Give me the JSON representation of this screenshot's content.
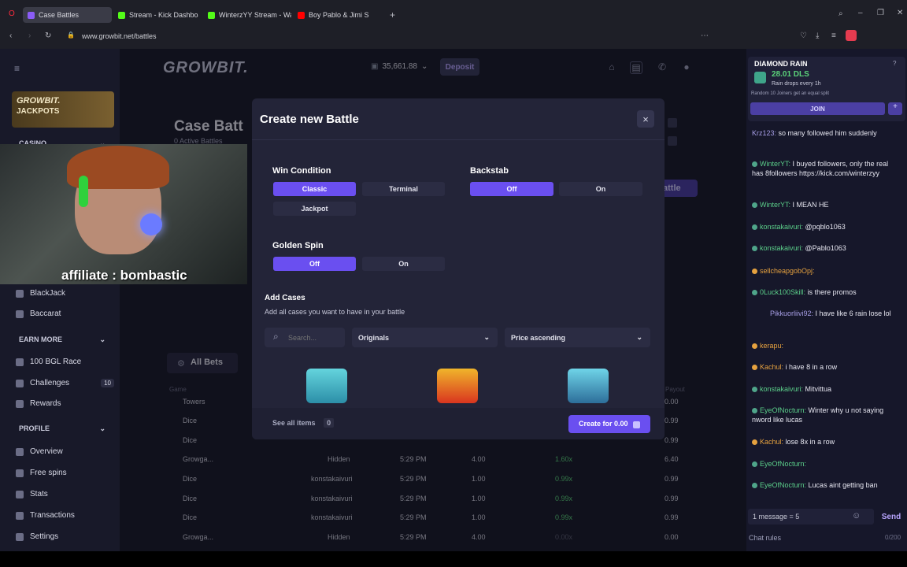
{
  "browser": {
    "tabs": [
      {
        "label": "Case Battles",
        "color": "#8b5cf6"
      },
      {
        "label": "Stream - Kick Dashboard",
        "color": "#53fc18"
      },
      {
        "label": "WinterzYY Stream - Watch",
        "color": "#53fc18"
      },
      {
        "label": "Boy Pablo & Jimi S",
        "color": "#ff0000"
      }
    ],
    "url": "www.growbit.net/battles"
  },
  "header": {
    "logo": "GROWBIT.",
    "balance": "35,661.88",
    "deposit_label": "Deposit"
  },
  "sidebar": {
    "jackpots_line1": "GROWBIT.",
    "jackpots_line2": "JACKPOTS",
    "casino_label": "CASINO",
    "casino_items": [
      {
        "label": "BlackJack"
      },
      {
        "label": "Baccarat"
      }
    ],
    "earn_more_label": "EARN MORE",
    "earn_items": [
      {
        "label": "100 BGL Race"
      },
      {
        "label": "Challenges",
        "badge": "10"
      },
      {
        "label": "Rewards"
      }
    ],
    "profile_label": "PROFILE",
    "profile_items": [
      {
        "label": "Overview"
      },
      {
        "label": "Free spins"
      },
      {
        "label": "Stats"
      },
      {
        "label": "Transactions"
      },
      {
        "label": "Settings"
      }
    ]
  },
  "page": {
    "title": "Case Batt",
    "subtitle": "0 Active Battles",
    "right_button": "attle",
    "all_bets_label": "All Bets",
    "game_header": "Game",
    "payout_header": "Payout",
    "rows": [
      {
        "game": "Towers",
        "user": "",
        "time": "",
        "amount": "",
        "mult": "",
        "payout": "0.00"
      },
      {
        "game": "Dice",
        "user": "",
        "time": "",
        "amount": "",
        "mult": "",
        "payout": "0.99"
      },
      {
        "game": "Dice",
        "user": "konstakaivuri",
        "time": "",
        "amount": "",
        "mult": "",
        "payout": "0.99"
      },
      {
        "game": "Growga...",
        "user": "Hidden",
        "time": "5:29 PM",
        "amount": "4.00",
        "mult": "1.60x",
        "payout": "6.40"
      },
      {
        "game": "Dice",
        "user": "konstakaivuri",
        "time": "5:29 PM",
        "amount": "1.00",
        "mult": "0.99x",
        "payout": "0.99"
      },
      {
        "game": "Dice",
        "user": "konstakaivuri",
        "time": "5:29 PM",
        "amount": "1.00",
        "mult": "0.99x",
        "payout": "0.99"
      },
      {
        "game": "Dice",
        "user": "konstakaivuri",
        "time": "5:29 PM",
        "amount": "1.00",
        "mult": "0.99x",
        "payout": "0.99"
      },
      {
        "game": "Growga...",
        "user": "Hidden",
        "time": "5:29 PM",
        "amount": "4.00",
        "mult": "0.00x",
        "payout": "0.00"
      }
    ]
  },
  "webcam": {
    "overlay_text": "affiliate : bombastic"
  },
  "modal": {
    "title": "Create new Battle",
    "close_icon": "×",
    "win_condition": {
      "title": "Win Condition",
      "options": [
        "Classic",
        "Terminal",
        "Jackpot"
      ],
      "selected": "Classic"
    },
    "backstab": {
      "title": "Backstab",
      "options": [
        "Off",
        "On"
      ],
      "selected": "Off"
    },
    "golden_spin": {
      "title": "Golden Spin",
      "options": [
        "Off",
        "On"
      ],
      "selected": "Off"
    },
    "add_cases": {
      "title": "Add Cases",
      "subtitle": "Add all cases you want to have in your battle",
      "search_placeholder": "Search...",
      "category": "Originals",
      "sort": "Price ascending"
    },
    "cases": [
      {
        "color": "#3fb6c9"
      },
      {
        "color": "#e8471f"
      },
      {
        "color": "#58b9d8"
      }
    ],
    "see_all_label": "See all items",
    "see_all_count": "0",
    "create_label": "Create for 0.00"
  },
  "chat": {
    "rain_title": "DIAMOND RAIN",
    "rain_amount": "28.01 DLS",
    "rain_sub1": "Rain drops every 1h",
    "rain_sub2": "Random 10 Joiners get an equal split",
    "join_label": "JOIN",
    "messages": [
      {
        "user": "Krz123:",
        "text": "so many followed him suddenly",
        "style": "p"
      },
      {
        "user": "WinterYT:",
        "text": "I buyed followers, only the real has 8followers https://kick.com/winterzyy",
        "style": "g"
      },
      {
        "user": "WinterYT:",
        "text": "I MEAN HE",
        "style": "g"
      },
      {
        "user": "konstakaivuri:",
        "text": "@pqblo1063",
        "style": "g"
      },
      {
        "user": "konstakaivuri:",
        "text": "@Pablo1063",
        "style": "g"
      },
      {
        "user": "sellcheapgobOpj:",
        "text": "",
        "style": "o"
      },
      {
        "user": "0Luck100Skill:",
        "text": "is there promos",
        "style": "g"
      },
      {
        "user": "Pikkuorliivi92:",
        "text": "I have like 6 rain lose lol",
        "style": "p"
      },
      {
        "user": "kerapu:",
        "text": "",
        "style": "o"
      },
      {
        "user": "Kachul:",
        "text": "i have 8 in a row",
        "style": "o"
      },
      {
        "user": "konstakaivuri:",
        "text": "Mitvittua",
        "style": "g"
      },
      {
        "user": "EyeOfNocturn:",
        "text": "Winter why u not saying nword like lucas",
        "style": "g"
      },
      {
        "user": "Kachul:",
        "text": "lose 8x in a row",
        "style": "o"
      },
      {
        "user": "EyeOfNocturn:",
        "text": "",
        "style": "g"
      },
      {
        "user": "EyeOfNocturn:",
        "text": "Lucas aint getting ban",
        "style": "g"
      }
    ],
    "input_value": "1 message = 5",
    "send_label": "Send",
    "rules_label": "Chat rules",
    "char_count": "0/200"
  }
}
